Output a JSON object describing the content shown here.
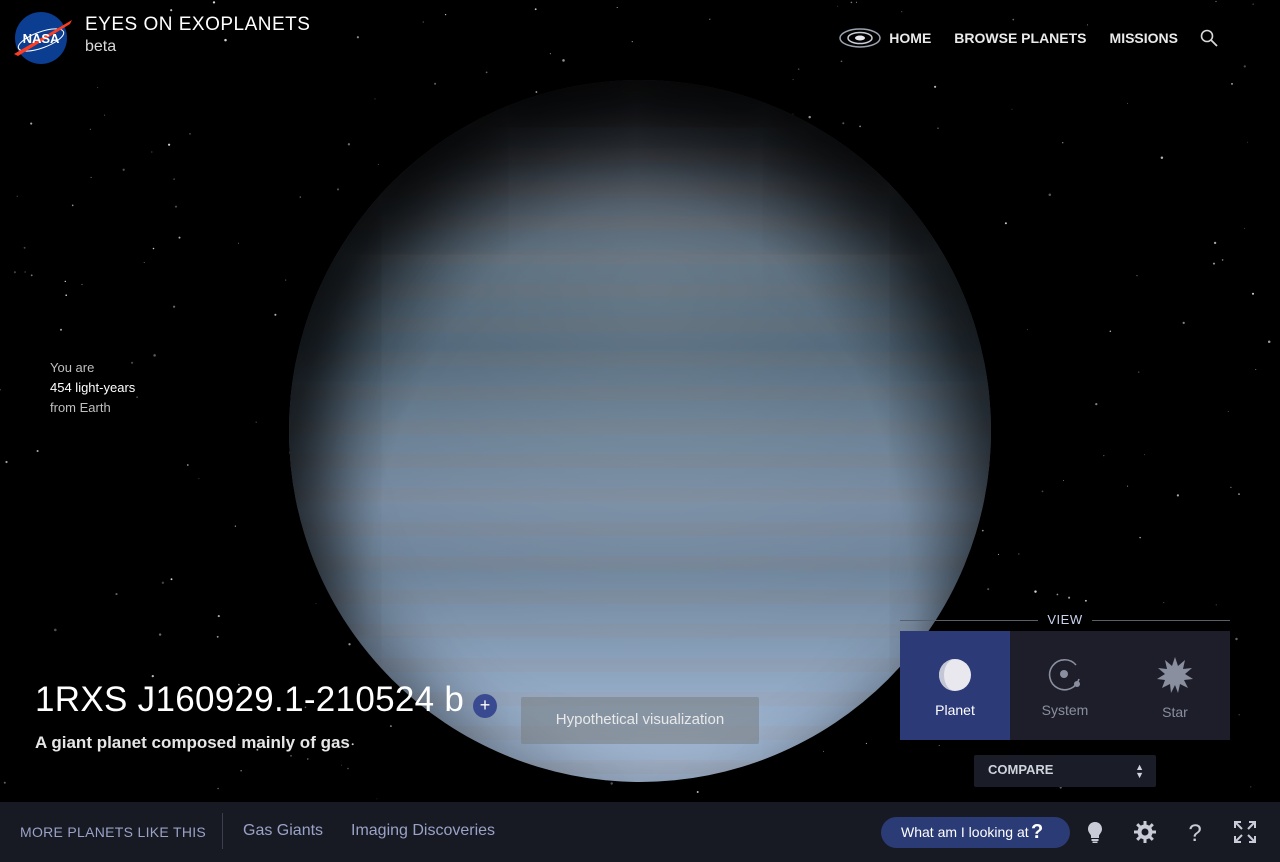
{
  "header": {
    "logo_text": "NASA",
    "title": "EYES ON EXOPLANETS",
    "subtitle": "beta"
  },
  "nav": {
    "items": [
      {
        "label": "HOME",
        "icon": "galaxy-icon"
      },
      {
        "label": "BROWSE PLANETS"
      },
      {
        "label": "MISSIONS"
      }
    ],
    "search_icon": "search-icon"
  },
  "distance": {
    "line1": "You are",
    "value": "454 light-years",
    "line3": "from Earth"
  },
  "planet": {
    "name": "1RXS J160929.1-210524 b",
    "add_label": "+",
    "description": "A giant planet composed mainly of gas",
    "visualization_note": "Hypothetical visualization"
  },
  "view": {
    "label": "VIEW",
    "options": [
      {
        "label": "Planet",
        "icon": "planet-icon",
        "active": true
      },
      {
        "label": "System",
        "icon": "system-icon",
        "active": false
      },
      {
        "label": "Star",
        "icon": "star-icon",
        "active": false
      }
    ],
    "compare_label": "COMPARE"
  },
  "bottom": {
    "more_label": "MORE PLANETS LIKE THIS",
    "categories": [
      "Gas Giants",
      "Imaging Discoveries"
    ],
    "help_button": "What am I looking at",
    "help_button_icon": "?",
    "tools": [
      "lightbulb-icon",
      "gear-icon",
      "help-icon",
      "fullscreen-icon"
    ]
  },
  "colors": {
    "accent": "#2d3a78",
    "bottom_bar": "#171923",
    "link": "#9aa2c6"
  }
}
